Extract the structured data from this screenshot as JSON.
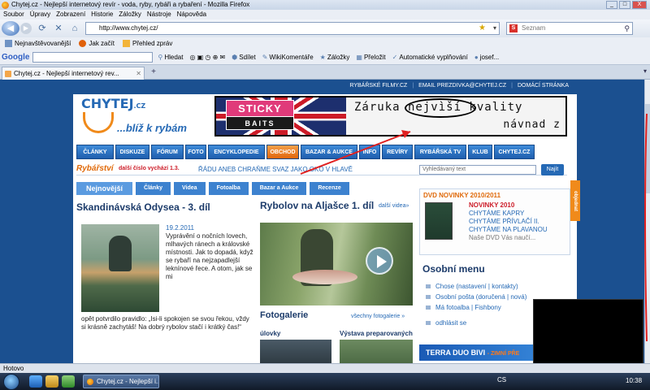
{
  "window": {
    "title": "Chytej.cz - Nejlepší internetový revír - voda, ryby, rybáři a rybaření - Mozilla Firefox",
    "buttons": [
      "_",
      "□",
      "X"
    ]
  },
  "menu": [
    "Soubor",
    "Úpravy",
    "Zobrazení",
    "Historie",
    "Záložky",
    "Nástroje",
    "Nápověda"
  ],
  "nav": {
    "url": "http://www.chytej.cz/",
    "search_placeholder": "Seznam"
  },
  "bookmarks": [
    "Nejnavštěvovanější",
    "Jak začít",
    "Přehled zpráv"
  ],
  "googlebar": {
    "logo": "Google",
    "items": [
      "Hledat",
      "Sdílet",
      "WikiKomentáře",
      "Záložky",
      "Přeložit",
      "Automatické vyplňování",
      "josef..."
    ]
  },
  "tab": {
    "title": "Chytej.cz - Nejlepší internetový rev...",
    "new_tab": "+"
  },
  "site": {
    "toplinks": [
      "RYBÁŘSKÉ FILMY.CZ",
      "EMAIL PREZDIVKA@CHYTEJ.CZ",
      "DOMÁCÍ STRÁNKA"
    ],
    "logo_name": "CHYTEJ",
    "logo_tld": ".CZ",
    "logo_tagline": "...blíž k rybám",
    "banner": {
      "brand_top": "STICKY",
      "brand_bottom": "BAITS",
      "slogan": "Záruka nejvìší kvality",
      "slogan2": "návnad z",
      "side_text": "10"
    },
    "mainnav": [
      "ČLÁNKY",
      "DISKUZE",
      "FÓRUM",
      "FOTO",
      "ENCYKLOPEDIE",
      "OBCHOD",
      "BAZAR & AUKCE",
      "INFO",
      "REVÍRY",
      "RYBÁŘSKÁ TV",
      "KLUB",
      "CHYTEJ.CZ"
    ],
    "rybarstvi": "Rybářství",
    "issue": "další číslo vychází 1.3.",
    "marquee": "ŘÁDU ANEB CHRAŇME SVAZ JAKO OKO V HLAVĚ",
    "search_placeholder": "Vyhledávaný text",
    "search_button": "Najít",
    "tabs": [
      "Nejnovější",
      "Články",
      "Videa",
      "Fotoalba",
      "Bazar a Aukce",
      "Recenze"
    ],
    "article": {
      "title": "Skandinávská Odysea - 3. díl",
      "date": "19.2.2011",
      "text": "Vyprávění o nočních lovech, mlhavých ránech a královské místnosti. Jak to dopadá, když se rybaří na nejzapadlejší leknínové řece. A otom, jak se mi",
      "text2": "opět potvrdilo pravidlo: „Isi-li spokojen se svou řekou, vždy si krásně zachytáš! Na dobrý rybolov stačí i krátký čas!“"
    },
    "video": {
      "title": "Rybolov na Aljašce 1. díl",
      "more": "další videa»"
    },
    "foto": {
      "title": "Fotogalerie",
      "more": "všechny fotogalerie »",
      "item1": "úlovky",
      "item2": "Výstava preparovaných"
    },
    "dvd": {
      "heading": "DVD NOVINKY 2010/2011",
      "items": [
        "NOVINKY 2010",
        "CHYTÁME KAPRY",
        "CHYTÁME PŘÍVLAČÍ II.",
        "CHYTÁME NA PLAVANOU",
        "Naše DVD Vás naučí..."
      ]
    },
    "osobni": {
      "heading": "Osobní menu",
      "row1": "Chose (nastavení | kontakty)",
      "row2": "Osobní pošta (doručená | nová)",
      "row3": "Má fotoalba | Fishbony",
      "row4": "odhlásit se"
    },
    "terra": "TERRA DUO BIVI",
    "terra_sub": "- ZIMNÍ PŘE",
    "sidetab": "objednat"
  },
  "status": "Hotovo",
  "taskbar": {
    "task": "Chytej.cz - Nejlepší i...",
    "lang": "CS",
    "clock": "10:38"
  }
}
